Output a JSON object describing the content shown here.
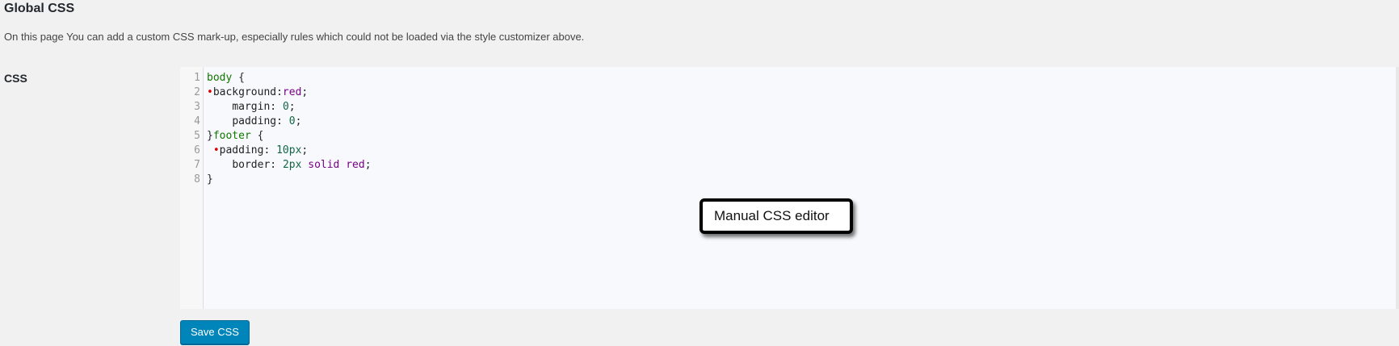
{
  "header": {
    "title": "Global CSS",
    "description": "On this page You can add a custom CSS mark-up, especially rules which could not be loaded via the style customizer above."
  },
  "form": {
    "field_label": "CSS",
    "save_label": "Save CSS"
  },
  "editor": {
    "lines": [
      {
        "num": "1",
        "dot": "",
        "indent": "",
        "sel": "body",
        "prop": "",
        "val": "",
        "kw": "",
        "rest": " {"
      },
      {
        "num": "2",
        "dot": "•",
        "indent": "",
        "sel": "",
        "prop": "background:",
        "val": "",
        "kw": "red",
        "rest": ";"
      },
      {
        "num": "3",
        "dot": "",
        "indent": "    ",
        "sel": "",
        "prop": "margin: ",
        "val": "0",
        "kw": "",
        "rest": ";"
      },
      {
        "num": "4",
        "dot": "",
        "indent": "    ",
        "sel": "",
        "prop": "padding: ",
        "val": "0",
        "kw": "",
        "rest": ";"
      },
      {
        "num": "5",
        "dot": "",
        "indent": "",
        "sel": "footer",
        "prop": "",
        "val": "",
        "kw": "",
        "rest": " {",
        "prefix": "}"
      },
      {
        "num": "6",
        "dot": "•",
        "indent": " ",
        "sel": "",
        "prop": "padding: ",
        "val": "10px",
        "kw": "",
        "rest": ";"
      },
      {
        "num": "7",
        "dot": "",
        "indent": "    ",
        "sel": "",
        "prop": "border: ",
        "val": "2px",
        "kw": " solid red",
        "rest": ";"
      },
      {
        "num": "8",
        "dot": "",
        "indent": "",
        "sel": "",
        "prop": "",
        "val": "",
        "kw": "",
        "rest": "}"
      }
    ]
  },
  "annotation": {
    "text": "Manual CSS editor"
  },
  "colors": {
    "button_bg": "#0085ba",
    "page_bg": "#f1f1f1",
    "editor_bg": "#f8f9fc"
  }
}
